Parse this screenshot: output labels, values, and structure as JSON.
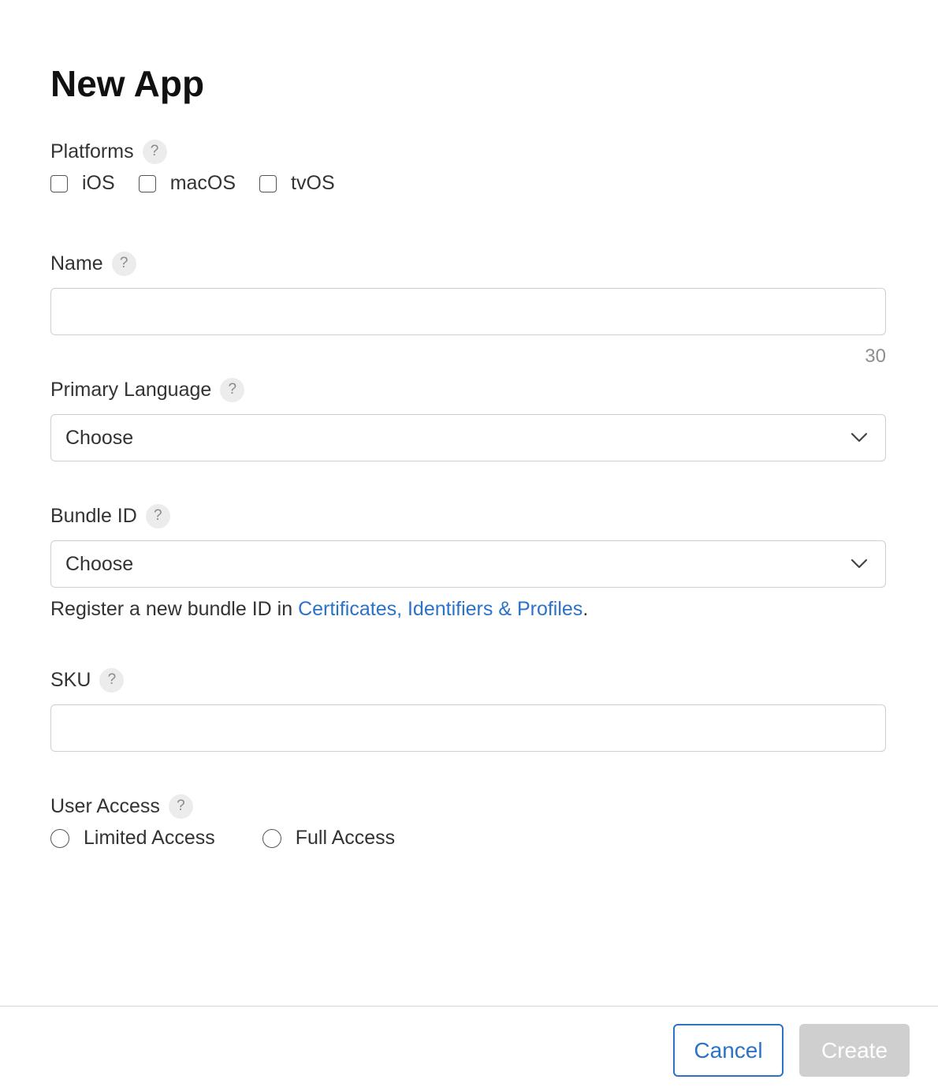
{
  "dialog": {
    "title": "New App"
  },
  "platforms": {
    "label": "Platforms",
    "help": "?",
    "options": [
      {
        "label": "iOS",
        "checked": false
      },
      {
        "label": "macOS",
        "checked": false
      },
      {
        "label": "tvOS",
        "checked": false
      }
    ]
  },
  "name": {
    "label": "Name",
    "help": "?",
    "value": "",
    "char_remaining": "30"
  },
  "primary_language": {
    "label": "Primary Language",
    "help": "?",
    "selected": "Choose"
  },
  "bundle_id": {
    "label": "Bundle ID",
    "help": "?",
    "selected": "Choose",
    "note_prefix": "Register a new bundle ID in ",
    "note_link": "Certificates, Identifiers & Profiles",
    "note_suffix": "."
  },
  "sku": {
    "label": "SKU",
    "help": "?",
    "value": ""
  },
  "user_access": {
    "label": "User Access",
    "help": "?",
    "options": [
      {
        "label": "Limited Access",
        "selected": false
      },
      {
        "label": "Full Access",
        "selected": false
      }
    ]
  },
  "footer": {
    "cancel_label": "Cancel",
    "create_label": "Create"
  },
  "colors": {
    "accent": "#2c72c7",
    "disabled_button": "#cfcfcf",
    "border": "#cfcfcf"
  },
  "icons": {
    "help": "question-mark-circle",
    "dropdown": "chevron-down"
  }
}
